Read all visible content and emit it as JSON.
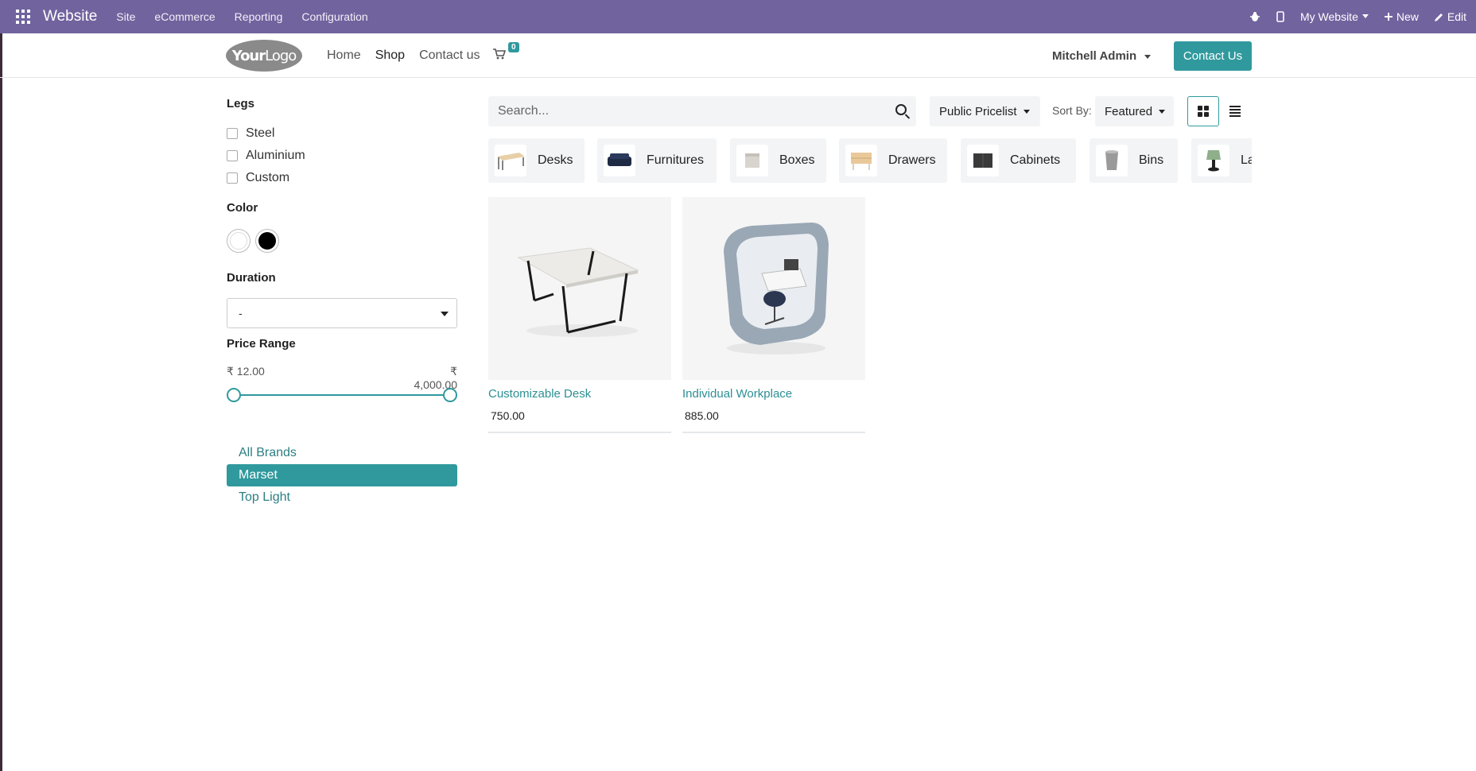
{
  "topbar": {
    "app_name": "Website",
    "menus": [
      "Site",
      "eCommerce",
      "Reporting",
      "Configuration"
    ],
    "website_selector": "My Website",
    "new_label": "New",
    "edit_label": "Edit"
  },
  "header": {
    "logo_text_bold": "Your",
    "logo_text_light": "Logo",
    "nav": [
      "Home",
      "Shop",
      "Contact us"
    ],
    "cart_count": "0",
    "user_name": "Mitchell Admin",
    "contact_button": "Contact Us"
  },
  "filters": {
    "legs_title": "Legs",
    "legs_options": [
      "Steel",
      "Aluminium",
      "Custom"
    ],
    "color_title": "Color",
    "colors": [
      "#ffffff",
      "#000000"
    ],
    "duration_title": "Duration",
    "duration_value": "-",
    "price_title": "Price Range",
    "price_min": "₹ 12.00",
    "price_max": "₹ 4,000.00",
    "brands": [
      "All Brands",
      "Marset",
      "Top Light"
    ],
    "active_brand": "Marset"
  },
  "toolbar": {
    "search_placeholder": "Search...",
    "pricelist": "Public Pricelist",
    "sort_label": "Sort By:",
    "sort_value": "Featured"
  },
  "categories": [
    "Desks",
    "Furnitures",
    "Boxes",
    "Drawers",
    "Cabinets",
    "Bins",
    "Lamps"
  ],
  "products": [
    {
      "name": "Customizable Desk",
      "price": "750.00"
    },
    {
      "name": "Individual Workplace",
      "price": "885.00"
    }
  ],
  "colors": {
    "admin_bar": "#71639e",
    "accent": "#30999d"
  }
}
